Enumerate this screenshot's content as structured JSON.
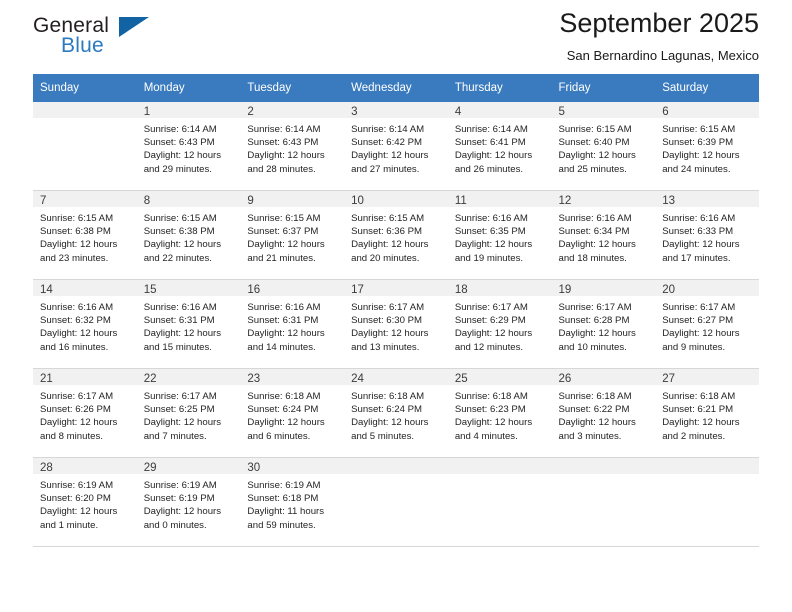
{
  "brand": {
    "name_top": "General",
    "name_bottom": "Blue",
    "triangle_color": "#1263a4",
    "blue_color": "#2a7ac0"
  },
  "header": {
    "title": "September 2025",
    "subtitle": "San Bernardino Lagunas, Mexico"
  },
  "theme": {
    "header_bg": "#3a7abe",
    "daynum_bg": "#f1f1f1",
    "cell_bg": "#ffffff",
    "grid_line": "#d7d7d7"
  },
  "weekday_headers": [
    "Sunday",
    "Monday",
    "Tuesday",
    "Wednesday",
    "Thursday",
    "Friday",
    "Saturday"
  ],
  "weeks": [
    [
      {
        "day": "",
        "empty": true,
        "sunrise": "",
        "sunset": "",
        "daylight_1": "",
        "daylight_2": ""
      },
      {
        "day": "1",
        "sunrise": "Sunrise: 6:14 AM",
        "sunset": "Sunset: 6:43 PM",
        "daylight_1": "Daylight: 12 hours",
        "daylight_2": "and 29 minutes."
      },
      {
        "day": "2",
        "sunrise": "Sunrise: 6:14 AM",
        "sunset": "Sunset: 6:43 PM",
        "daylight_1": "Daylight: 12 hours",
        "daylight_2": "and 28 minutes."
      },
      {
        "day": "3",
        "sunrise": "Sunrise: 6:14 AM",
        "sunset": "Sunset: 6:42 PM",
        "daylight_1": "Daylight: 12 hours",
        "daylight_2": "and 27 minutes."
      },
      {
        "day": "4",
        "sunrise": "Sunrise: 6:14 AM",
        "sunset": "Sunset: 6:41 PM",
        "daylight_1": "Daylight: 12 hours",
        "daylight_2": "and 26 minutes."
      },
      {
        "day": "5",
        "sunrise": "Sunrise: 6:15 AM",
        "sunset": "Sunset: 6:40 PM",
        "daylight_1": "Daylight: 12 hours",
        "daylight_2": "and 25 minutes."
      },
      {
        "day": "6",
        "sunrise": "Sunrise: 6:15 AM",
        "sunset": "Sunset: 6:39 PM",
        "daylight_1": "Daylight: 12 hours",
        "daylight_2": "and 24 minutes."
      }
    ],
    [
      {
        "day": "7",
        "sunrise": "Sunrise: 6:15 AM",
        "sunset": "Sunset: 6:38 PM",
        "daylight_1": "Daylight: 12 hours",
        "daylight_2": "and 23 minutes."
      },
      {
        "day": "8",
        "sunrise": "Sunrise: 6:15 AM",
        "sunset": "Sunset: 6:38 PM",
        "daylight_1": "Daylight: 12 hours",
        "daylight_2": "and 22 minutes."
      },
      {
        "day": "9",
        "sunrise": "Sunrise: 6:15 AM",
        "sunset": "Sunset: 6:37 PM",
        "daylight_1": "Daylight: 12 hours",
        "daylight_2": "and 21 minutes."
      },
      {
        "day": "10",
        "sunrise": "Sunrise: 6:15 AM",
        "sunset": "Sunset: 6:36 PM",
        "daylight_1": "Daylight: 12 hours",
        "daylight_2": "and 20 minutes."
      },
      {
        "day": "11",
        "sunrise": "Sunrise: 6:16 AM",
        "sunset": "Sunset: 6:35 PM",
        "daylight_1": "Daylight: 12 hours",
        "daylight_2": "and 19 minutes."
      },
      {
        "day": "12",
        "sunrise": "Sunrise: 6:16 AM",
        "sunset": "Sunset: 6:34 PM",
        "daylight_1": "Daylight: 12 hours",
        "daylight_2": "and 18 minutes."
      },
      {
        "day": "13",
        "sunrise": "Sunrise: 6:16 AM",
        "sunset": "Sunset: 6:33 PM",
        "daylight_1": "Daylight: 12 hours",
        "daylight_2": "and 17 minutes."
      }
    ],
    [
      {
        "day": "14",
        "sunrise": "Sunrise: 6:16 AM",
        "sunset": "Sunset: 6:32 PM",
        "daylight_1": "Daylight: 12 hours",
        "daylight_2": "and 16 minutes."
      },
      {
        "day": "15",
        "sunrise": "Sunrise: 6:16 AM",
        "sunset": "Sunset: 6:31 PM",
        "daylight_1": "Daylight: 12 hours",
        "daylight_2": "and 15 minutes."
      },
      {
        "day": "16",
        "sunrise": "Sunrise: 6:16 AM",
        "sunset": "Sunset: 6:31 PM",
        "daylight_1": "Daylight: 12 hours",
        "daylight_2": "and 14 minutes."
      },
      {
        "day": "17",
        "sunrise": "Sunrise: 6:17 AM",
        "sunset": "Sunset: 6:30 PM",
        "daylight_1": "Daylight: 12 hours",
        "daylight_2": "and 13 minutes."
      },
      {
        "day": "18",
        "sunrise": "Sunrise: 6:17 AM",
        "sunset": "Sunset: 6:29 PM",
        "daylight_1": "Daylight: 12 hours",
        "daylight_2": "and 12 minutes."
      },
      {
        "day": "19",
        "sunrise": "Sunrise: 6:17 AM",
        "sunset": "Sunset: 6:28 PM",
        "daylight_1": "Daylight: 12 hours",
        "daylight_2": "and 10 minutes."
      },
      {
        "day": "20",
        "sunrise": "Sunrise: 6:17 AM",
        "sunset": "Sunset: 6:27 PM",
        "daylight_1": "Daylight: 12 hours",
        "daylight_2": "and 9 minutes."
      }
    ],
    [
      {
        "day": "21",
        "sunrise": "Sunrise: 6:17 AM",
        "sunset": "Sunset: 6:26 PM",
        "daylight_1": "Daylight: 12 hours",
        "daylight_2": "and 8 minutes."
      },
      {
        "day": "22",
        "sunrise": "Sunrise: 6:17 AM",
        "sunset": "Sunset: 6:25 PM",
        "daylight_1": "Daylight: 12 hours",
        "daylight_2": "and 7 minutes."
      },
      {
        "day": "23",
        "sunrise": "Sunrise: 6:18 AM",
        "sunset": "Sunset: 6:24 PM",
        "daylight_1": "Daylight: 12 hours",
        "daylight_2": "and 6 minutes."
      },
      {
        "day": "24",
        "sunrise": "Sunrise: 6:18 AM",
        "sunset": "Sunset: 6:24 PM",
        "daylight_1": "Daylight: 12 hours",
        "daylight_2": "and 5 minutes."
      },
      {
        "day": "25",
        "sunrise": "Sunrise: 6:18 AM",
        "sunset": "Sunset: 6:23 PM",
        "daylight_1": "Daylight: 12 hours",
        "daylight_2": "and 4 minutes."
      },
      {
        "day": "26",
        "sunrise": "Sunrise: 6:18 AM",
        "sunset": "Sunset: 6:22 PM",
        "daylight_1": "Daylight: 12 hours",
        "daylight_2": "and 3 minutes."
      },
      {
        "day": "27",
        "sunrise": "Sunrise: 6:18 AM",
        "sunset": "Sunset: 6:21 PM",
        "daylight_1": "Daylight: 12 hours",
        "daylight_2": "and 2 minutes."
      }
    ],
    [
      {
        "day": "28",
        "sunrise": "Sunrise: 6:19 AM",
        "sunset": "Sunset: 6:20 PM",
        "daylight_1": "Daylight: 12 hours",
        "daylight_2": "and 1 minute."
      },
      {
        "day": "29",
        "sunrise": "Sunrise: 6:19 AM",
        "sunset": "Sunset: 6:19 PM",
        "daylight_1": "Daylight: 12 hours",
        "daylight_2": "and 0 minutes."
      },
      {
        "day": "30",
        "sunrise": "Sunrise: 6:19 AM",
        "sunset": "Sunset: 6:18 PM",
        "daylight_1": "Daylight: 11 hours",
        "daylight_2": "and 59 minutes."
      },
      {
        "day": "",
        "empty": true,
        "sunrise": "",
        "sunset": "",
        "daylight_1": "",
        "daylight_2": ""
      },
      {
        "day": "",
        "empty": true,
        "sunrise": "",
        "sunset": "",
        "daylight_1": "",
        "daylight_2": ""
      },
      {
        "day": "",
        "empty": true,
        "sunrise": "",
        "sunset": "",
        "daylight_1": "",
        "daylight_2": ""
      },
      {
        "day": "",
        "empty": true,
        "sunrise": "",
        "sunset": "",
        "daylight_1": "",
        "daylight_2": ""
      }
    ]
  ]
}
